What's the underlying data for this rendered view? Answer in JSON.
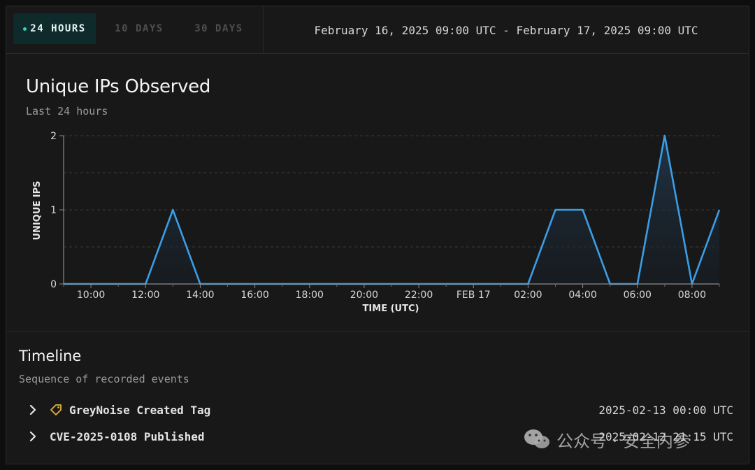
{
  "header": {
    "tabs": [
      {
        "label": "24 HOURS",
        "active": true
      },
      {
        "label": "10 DAYS",
        "active": false
      },
      {
        "label": "30 DAYS",
        "active": false
      }
    ],
    "date_range": "February 16, 2025 09:00 UTC - February 17, 2025 09:00 UTC"
  },
  "chart": {
    "title": "Unique IPs Observed",
    "subtitle": "Last 24 hours"
  },
  "chart_data": {
    "type": "area",
    "title": "Unique IPs Observed",
    "subtitle": "Last 24 hours",
    "xlabel": "TIME (UTC)",
    "ylabel": "UNIQUE IPS",
    "x_ticks": [
      "10:00",
      "12:00",
      "14:00",
      "16:00",
      "18:00",
      "20:00",
      "22:00",
      "FEB 17",
      "02:00",
      "04:00",
      "06:00",
      "08:00"
    ],
    "y_ticks": [
      "0",
      "1",
      "2"
    ],
    "ylim": [
      0,
      2
    ],
    "x": [
      "09:00",
      "10:00",
      "11:00",
      "12:00",
      "13:00",
      "14:00",
      "15:00",
      "16:00",
      "17:00",
      "18:00",
      "19:00",
      "20:00",
      "21:00",
      "22:00",
      "23:00",
      "00:00",
      "01:00",
      "02:00",
      "03:00",
      "04:00",
      "05:00",
      "06:00",
      "07:00",
      "08:00",
      "09:00"
    ],
    "series": [
      {
        "values": [
          0,
          0,
          0,
          0,
          1,
          0,
          0,
          0,
          0,
          0,
          0,
          0,
          0,
          0,
          0,
          0,
          0,
          0,
          1,
          1,
          0,
          0,
          2,
          0,
          1
        ]
      }
    ],
    "grid": true,
    "line_color": "#3b9de6",
    "fill_color": "#1c2a38"
  },
  "timeline": {
    "title": "Timeline",
    "subtitle": "Sequence of recorded events",
    "events": [
      {
        "label": "GreyNoise Created Tag",
        "time": "2025-02-13 00:00 UTC",
        "icon": "tag-icon"
      },
      {
        "label": "CVE-2025-0108 Published",
        "time": "2025-02-12 21:15 UTC",
        "icon": ""
      }
    ]
  },
  "watermark": {
    "text": "公众号 · 安全内参",
    "icon": "wechat-icon"
  },
  "colors": {
    "accent": "#2fd3c0",
    "tag_icon": "#e8b43a"
  }
}
